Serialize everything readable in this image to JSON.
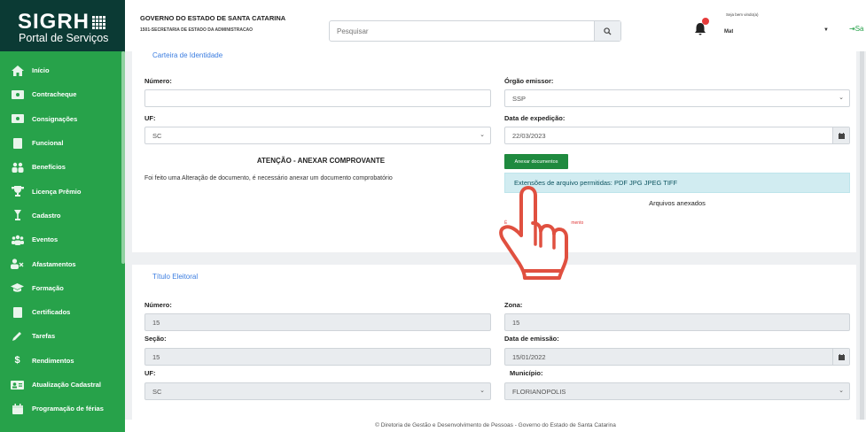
{
  "brand": {
    "logo": "SIGRH",
    "subtitle": "Portal de Serviços"
  },
  "sidebar": {
    "items": [
      {
        "label": "Início",
        "icon": "home-icon"
      },
      {
        "label": "Contracheque",
        "icon": "money-icon"
      },
      {
        "label": "Consignações",
        "icon": "money-icon"
      },
      {
        "label": "Funcional",
        "icon": "document-icon"
      },
      {
        "label": "Benefícios",
        "icon": "users-icon"
      },
      {
        "label": "Licença Prêmio",
        "icon": "trophy-icon"
      },
      {
        "label": "Cadastro",
        "icon": "cocktail-icon"
      },
      {
        "label": "Eventos",
        "icon": "users-icon"
      },
      {
        "label": "Afastamentos",
        "icon": "user-times-icon"
      },
      {
        "label": "Formação",
        "icon": "graduation-cap-icon"
      },
      {
        "label": "Certificados",
        "icon": "document-icon"
      },
      {
        "label": "Tarefas",
        "icon": "pencil-icon"
      },
      {
        "label": "Rendimentos",
        "icon": "dollar-icon"
      },
      {
        "label": "Atualização Cadastral",
        "icon": "id-card-icon"
      },
      {
        "label": "Programação de férias",
        "icon": "calendar-icon"
      }
    ]
  },
  "header": {
    "gov_title": "GOVERNO DO ESTADO DE SANTA CATARINA",
    "gov_sub": "1501-SECRETARIA DE ESTADO DA ADMINISTRACAO",
    "search_placeholder": "Pesquisar",
    "greeting": "Seja bem vindo(a)",
    "matricula_label": "Matrícula: ",
    "matricula_value": "",
    "logout_label": "Sa"
  },
  "identidade": {
    "title": "Carteira de Identidade",
    "numero_label": "Número:",
    "numero_value": "",
    "orgao_label": "Órgão emissor:",
    "orgao_value": "SSP",
    "uf_label": "UF:",
    "uf_value": "SC",
    "data_exp_label": "Data de expedição:",
    "data_exp_value": "22/03/2023",
    "warn_title": "ATENÇÃO - ANEXAR COMPROVANTE",
    "warn_text": "Foi feito uma Alteração de documento, é necessário anexar um documento comprobatório",
    "attach_button": "Anexar documentos",
    "extensions": "Extensões de arquivo permitidas: PDF JPG JPEG TIFF",
    "attached_title": "Arquivos anexados",
    "note_prefix": "É",
    "note_suffix": "mento"
  },
  "titulo": {
    "title": "Título Eleitoral",
    "numero_label": "Número:",
    "numero_value": "15",
    "zona_label": "Zona:",
    "zona_value": "15",
    "secao_label": "Seção:",
    "secao_value": "15",
    "data_em_label": "Data de emissão:",
    "data_em_value": "15/01/2022",
    "uf_label": "UF:",
    "uf_value": "SC",
    "municipio_label": "Município:",
    "municipio_value": "FLORIANOPOLIS"
  },
  "footer": {
    "text": "© Diretoria de Gestão e Desenvolvimento de Pessoas - Governo do Estado de Santa Catarina"
  },
  "colors": {
    "sidebar": "#27a24a",
    "dark": "#0b3a34",
    "link": "#3b7de0",
    "hand": "#e05040"
  }
}
